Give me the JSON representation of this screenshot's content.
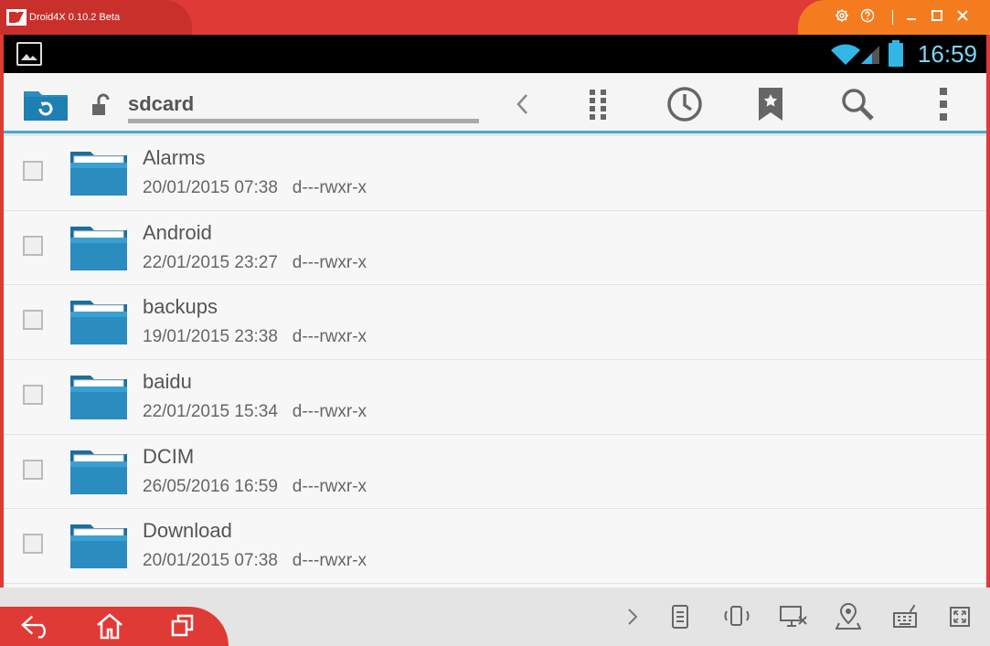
{
  "window": {
    "title": "Droid4X 0.10.2 Beta"
  },
  "statusbar": {
    "time": "16:59"
  },
  "actionbar": {
    "path": "sdcard"
  },
  "files": [
    {
      "name": "Alarms",
      "date": "20/01/2015 07:38",
      "perms": "d---rwxr-x"
    },
    {
      "name": "Android",
      "date": "22/01/2015 23:27",
      "perms": "d---rwxr-x"
    },
    {
      "name": "backups",
      "date": "19/01/2015 23:38",
      "perms": "d---rwxr-x"
    },
    {
      "name": "baidu",
      "date": "22/01/2015 15:34",
      "perms": "d---rwxr-x"
    },
    {
      "name": "DCIM",
      "date": "26/05/2016 16:59",
      "perms": "d---rwxr-x"
    },
    {
      "name": "Download",
      "date": "20/01/2015 07:38",
      "perms": "d---rwxr-x"
    }
  ],
  "colors": {
    "accent": "#4aa8c9",
    "frame": "#e03a36",
    "title_controls": "#f47c1f",
    "folder": "#2a8cbf",
    "clock": "#7ed4f5"
  },
  "icons": {
    "title": [
      "settings-icon",
      "help-icon",
      "minimize-icon",
      "maximize-icon",
      "close-icon"
    ],
    "actionbar": [
      "back-chevron-icon",
      "grid-view-icon",
      "history-icon",
      "bookmark-icon",
      "search-icon",
      "overflow-menu-icon"
    ],
    "navigation": [
      "back-icon",
      "home-icon",
      "recent-apps-icon"
    ],
    "tools": [
      "expand-arrow-icon",
      "apk-install-icon",
      "shake-icon",
      "screenshot-icon",
      "location-icon",
      "keyboard-icon",
      "fullscreen-icon"
    ]
  }
}
